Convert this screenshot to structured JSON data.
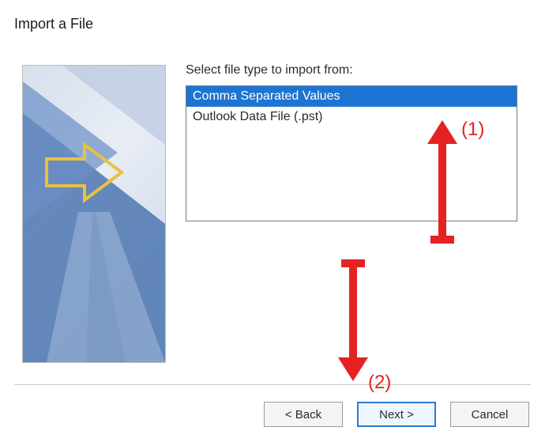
{
  "dialog": {
    "title": "Import a File",
    "list_label": "Select file type to import from:",
    "file_types": [
      {
        "label": "Comma Separated Values",
        "selected": true
      },
      {
        "label": "Outlook Data File (.pst)",
        "selected": false
      }
    ],
    "buttons": {
      "back": "< Back",
      "next": "Next >",
      "cancel": "Cancel"
    }
  },
  "annotations": {
    "one": "(1)",
    "two": "(2)",
    "color": "#e42222"
  }
}
